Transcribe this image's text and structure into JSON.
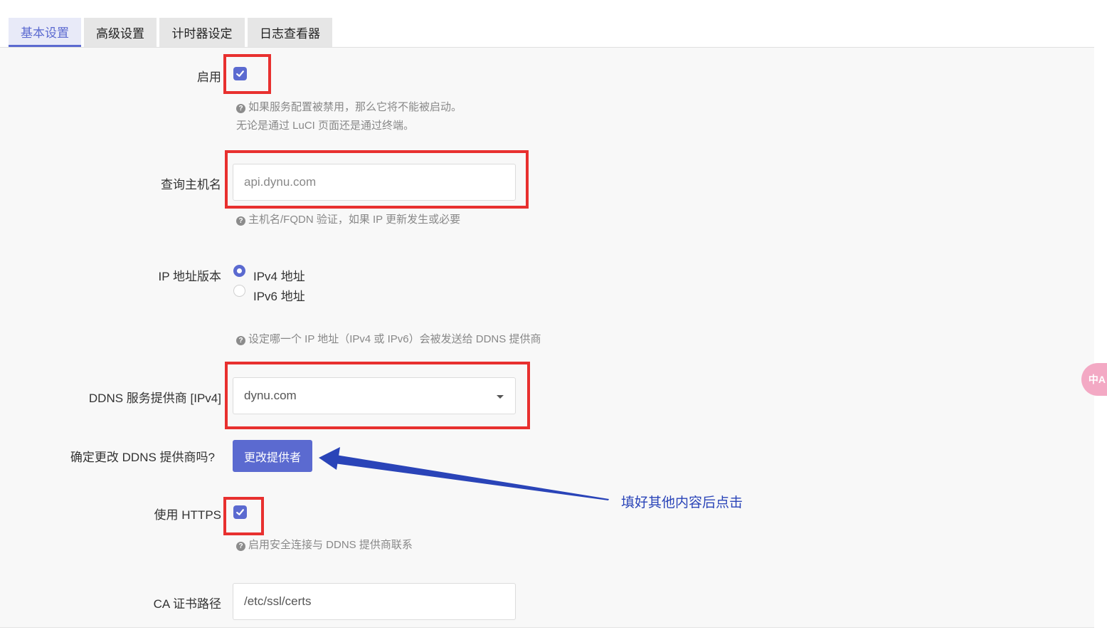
{
  "tabs": [
    {
      "label": "基本设置",
      "active": true
    },
    {
      "label": "高级设置",
      "active": false
    },
    {
      "label": "计时器设定",
      "active": false
    },
    {
      "label": "日志查看器",
      "active": false
    }
  ],
  "enable": {
    "label": "启用",
    "checked": true,
    "help_line1": "如果服务配置被禁用，那么它将不能被启动。",
    "help_line2": "无论是通过 LuCI 页面还是通过终端。"
  },
  "lookup_host": {
    "label": "查询主机名",
    "placeholder": "api.dynu.com",
    "help": "主机名/FQDN 验证，如果 IP 更新发生或必要"
  },
  "ip_version": {
    "label": "IP 地址版本",
    "options": [
      {
        "label": "IPv4 地址",
        "selected": true
      },
      {
        "label": "IPv6 地址",
        "selected": false
      }
    ],
    "help": "设定哪一个 IP 地址（IPv4 或 IPv6）会被发送给 DDNS 提供商"
  },
  "provider": {
    "label": "DDNS 服务提供商 [IPv4]",
    "selected": "dynu.com"
  },
  "change_provider": {
    "label": "确定更改 DDNS 提供商吗?",
    "button": "更改提供者"
  },
  "use_https": {
    "label": "使用 HTTPS",
    "checked": true,
    "help": "启用安全连接与 DDNS 提供商联系"
  },
  "ca_path": {
    "label": "CA 证书路径",
    "value": "/etc/ssl/certs"
  },
  "annotation": {
    "text": "填好其他内容后点击"
  },
  "floating_badge": {
    "text": "中A"
  },
  "colors": {
    "accent": "#5b6ad0",
    "highlight_box": "#e8302f",
    "annotation": "#2a44b8"
  }
}
